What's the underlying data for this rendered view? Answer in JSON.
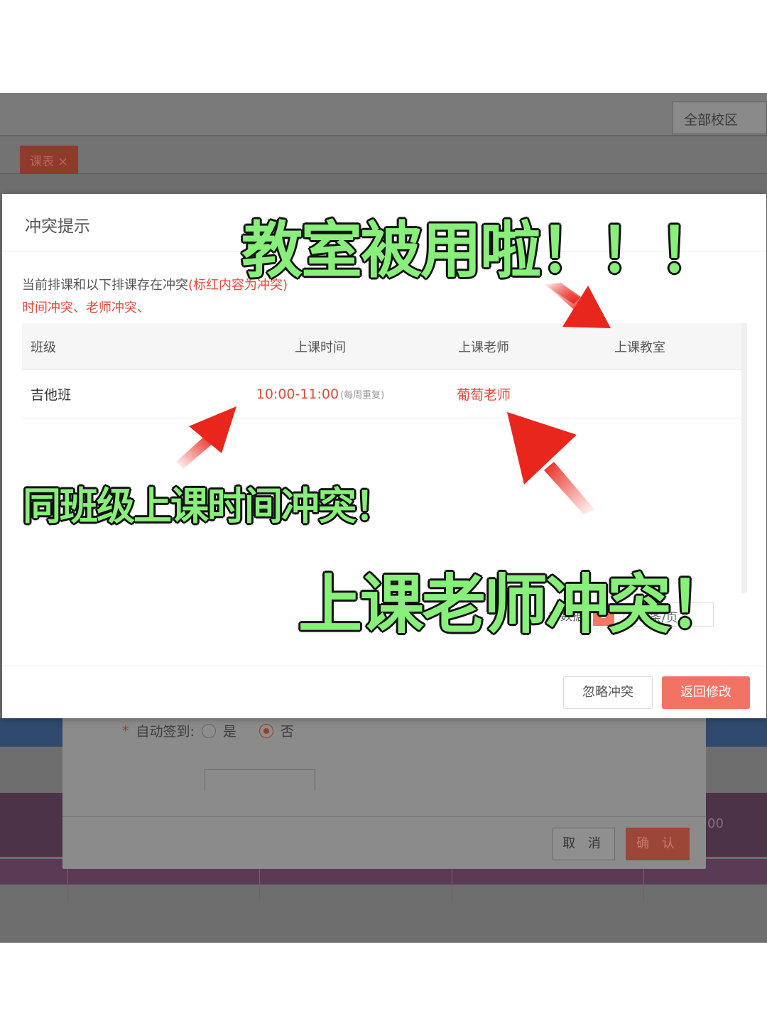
{
  "background": {
    "campus_select": "全部校区",
    "tab_label": "课表 ×",
    "form": {
      "auto_signin_label": "自动签到:",
      "option_yes": "是",
      "option_no": "否",
      "cancel_label": "取 消",
      "confirm_label": "确 认"
    },
    "dim_number": "00"
  },
  "modal": {
    "title": "冲突提示",
    "description": "当前排课和以下排课存在冲突",
    "description_note": "(标红内容为冲突)",
    "conflict_types": "时间冲突、老师冲突、",
    "table": {
      "headers": [
        "班级",
        "上课时间",
        "上课老师",
        "上课教室"
      ],
      "rows": [
        {
          "class": "吉他班",
          "time": "10:00-11:00",
          "repeat": "(每周重复)",
          "teacher": "葡萄老师",
          "room": ""
        }
      ]
    },
    "pager": {
      "total_label": "共 1 条数据",
      "current_page": "1",
      "page_size": "10 条/页"
    },
    "buttons": {
      "ignore": "忽略冲突",
      "back": "返回修改"
    }
  },
  "annotations": {
    "room_used": "教室被用啦！！！",
    "same_class_time": "同班级上课时间冲突！",
    "teacher_conflict": "上课老师冲突！"
  },
  "colors": {
    "accent": "#f27363",
    "conflict_red": "#e04a3a",
    "annotation_green": "#88f07a",
    "arrow_red": "#e8261c"
  }
}
